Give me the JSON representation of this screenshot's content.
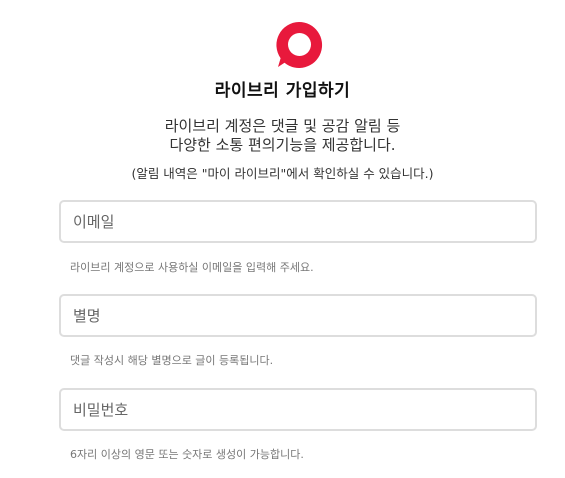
{
  "header": {
    "logo_icon": "speech-bubble-logo-icon",
    "brand_color": "#e8193c",
    "title": "라이브리 가입하기"
  },
  "intro": {
    "line1": "라이브리 계정은 댓글 및 공감 알림 등",
    "line2": "다양한 소통 편의기능을 제공합니다.",
    "note": "(알림 내역은 \"마이 라이브리\"에서 확인하실 수 있습니다.)"
  },
  "form": {
    "email": {
      "placeholder": "이메일",
      "value": "",
      "help": "라이브리 계정으로 사용하실 이메일을 입력해 주세요."
    },
    "nickname": {
      "placeholder": "별명",
      "value": "",
      "help": "댓글 작성시 해당 별명으로 글이 등록됩니다."
    },
    "password": {
      "placeholder": "비밀번호",
      "value": "",
      "help": "6자리 이상의 영문 또는 숫자로 생성이 가능합니다."
    }
  }
}
